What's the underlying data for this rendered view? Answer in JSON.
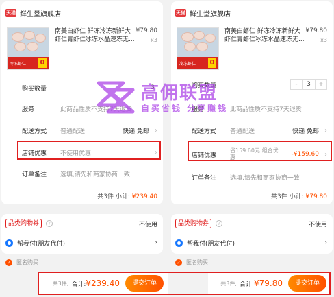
{
  "store": {
    "badge": "天猫",
    "name": "鲜生堂旗舰店"
  },
  "product": {
    "title": "南美白虾仁 鲜冻冷冻新鲜大虾仁青虾仁冰冻水晶速冻无...",
    "price": "¥79.80",
    "qty": "x3",
    "image_badge": "0"
  },
  "rows": {
    "quantity_label": "购买数量",
    "quantity_value": "3",
    "service_label": "服务",
    "service_value": "此商品性质不支持7天退货",
    "delivery_label": "配送方式",
    "delivery_value": "普通配送",
    "delivery_right": "快递 免邮",
    "discount_label": "店铺优惠",
    "remark_label": "订单备注",
    "remark_value": "选填,请先和商家协商一致"
  },
  "left": {
    "discount_value": "不使用优惠",
    "subtotal_prefix": "共3件 小计:",
    "subtotal_price": "¥239.40",
    "total_count": "共3件,",
    "total_label": "合计:",
    "total_price": "¥239.40"
  },
  "right": {
    "discount_value": "省159.60元:组合优惠",
    "discount_amount": "-¥159.60",
    "subtotal_prefix": "共3件 小计:",
    "subtotal_price": "¥79.80",
    "total_count": "共3件,",
    "total_label": "合计:",
    "total_price": "¥79.80"
  },
  "category": {
    "tag": "品类购物券",
    "help": "?",
    "value": "不使用",
    "friend_pay": "帮我付(朋友代付)"
  },
  "anon": "匿名购买",
  "submit_label": "提交订单",
  "stepper": {
    "minus": "-",
    "plus": "+"
  },
  "watermark": {
    "title": "高佣联盟",
    "sub": "自买省钱 分享赚钱"
  },
  "colors": {
    "accent": "#ff5000",
    "highlight_box": "#e02020",
    "brand_red": "#e4393c"
  }
}
